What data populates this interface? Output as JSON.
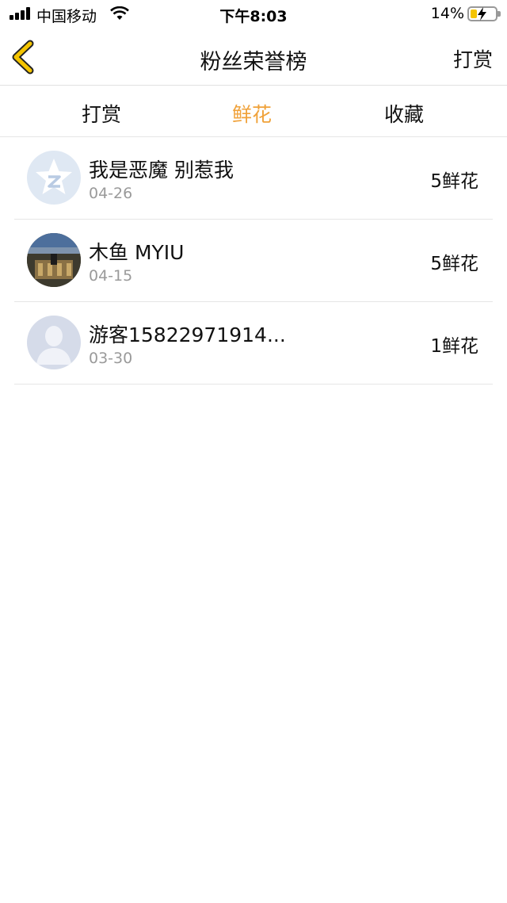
{
  "status_bar": {
    "carrier": "中国移动",
    "time": "下午8:03",
    "battery": "14%"
  },
  "nav": {
    "title": "粉丝荣誉榜",
    "action": "打赏"
  },
  "tabs": [
    {
      "label": "打赏",
      "active": false
    },
    {
      "label": "鲜花",
      "active": true
    },
    {
      "label": "收藏",
      "active": false
    }
  ],
  "list": [
    {
      "name": "我是恶魔 别惹我",
      "date": "04-26",
      "amount": "5鲜花",
      "avatar": "qq-zone-avatar"
    },
    {
      "name": "木鱼 MYIU",
      "date": "04-15",
      "amount": "5鲜花",
      "avatar": "photo-avatar"
    },
    {
      "name": "游客15822971914...",
      "date": "03-30",
      "amount": "1鲜花",
      "avatar": "default-user-avatar"
    }
  ],
  "colors": {
    "accent": "#f0a23a",
    "back_arrow": "#f4c400",
    "divider": "#e6e6e6"
  }
}
